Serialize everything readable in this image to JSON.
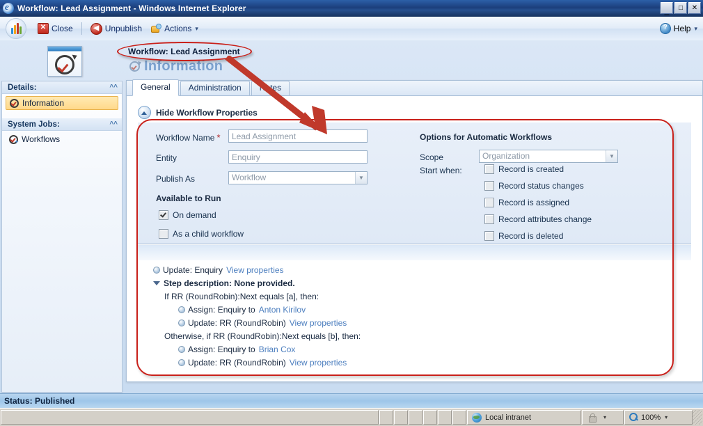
{
  "window": {
    "title": "Workflow: Lead Assignment - Windows Internet Explorer",
    "ie_icon": "internet-explorer-icon",
    "minimize": "_",
    "maximize": "□",
    "close": "✕"
  },
  "toolbar": {
    "app_logo": "dynamics-crm-logo",
    "close_label": "Close",
    "close_icon": "close-x-icon",
    "unpublish_label": "Unpublish",
    "unpublish_icon": "unpublish-icon",
    "actions_label": "Actions",
    "actions_icon": "actions-hand-icon",
    "actions_caret": "▾",
    "help_label": "Help",
    "help_icon": "help-question-icon",
    "help_caret": "▾"
  },
  "header": {
    "record_icon": "workflow-window-icon",
    "breadcrumb": "Workflow: Lead Assignment",
    "page_title": "Information",
    "page_title_icon": "workflow-check-icon"
  },
  "sidebar": {
    "groups": [
      {
        "header": "Details:",
        "collapse_icon": "chevron-up-icon",
        "items": [
          {
            "label": "Information",
            "icon": "workflow-check-icon",
            "selected": true
          }
        ]
      },
      {
        "header": "System Jobs:",
        "collapse_icon": "chevron-up-icon",
        "items": [
          {
            "label": "Workflows",
            "icon": "workflows-icon",
            "selected": false
          }
        ]
      }
    ]
  },
  "tabs": [
    {
      "label": "General",
      "active": true
    },
    {
      "label": "Administration",
      "active": false
    },
    {
      "label": "Notes",
      "active": false
    }
  ],
  "properties_section": {
    "toggle_label": "Hide Workflow Properties",
    "toggle_icon": "chevron-up-circle-icon",
    "fields": [
      {
        "label": "Workflow Name",
        "required": true,
        "value": "Lead Assignment",
        "type": "text"
      },
      {
        "label": "Entity",
        "required": false,
        "value": "Enquiry",
        "type": "text"
      },
      {
        "label": "Publish As",
        "required": false,
        "value": "Workflow",
        "type": "select"
      }
    ],
    "available_to_run": {
      "heading": "Available to Run",
      "options": [
        {
          "label": "On demand",
          "checked": true
        },
        {
          "label": "As a child workflow",
          "checked": false
        }
      ]
    },
    "automatic_options": {
      "heading": "Options for Automatic Workflows",
      "scope_label": "Scope",
      "scope_value": "Organization",
      "start_when_label": "Start when:",
      "triggers": [
        {
          "label": "Record is created",
          "checked": false
        },
        {
          "label": "Record status changes",
          "checked": false
        },
        {
          "label": "Record is assigned",
          "checked": false
        },
        {
          "label": "Record attributes change",
          "checked": false
        },
        {
          "label": "Record is deleted",
          "checked": false
        }
      ]
    }
  },
  "steps": {
    "rows": [
      {
        "indent": 0,
        "bullet": "dot",
        "text": "Update:  Enquiry",
        "link": "View properties",
        "bold": false
      },
      {
        "indent": 0,
        "bullet": "triangle",
        "text": "Step description: None provided.",
        "link": "",
        "bold": true
      },
      {
        "indent": 1,
        "bullet": "none",
        "text": "If RR (RoundRobin):Next equals [a], then:",
        "link": "",
        "bold": false
      },
      {
        "indent": 2,
        "bullet": "dot",
        "text": "Assign:  Enquiry  to",
        "link": "Anton Kirilov",
        "bold": false
      },
      {
        "indent": 2,
        "bullet": "dot",
        "text": "Update:  RR (RoundRobin)",
        "link": "View properties",
        "bold": false
      },
      {
        "indent": 1,
        "bullet": "none",
        "text": "Otherwise, if RR (RoundRobin):Next equals [b], then:",
        "link": "",
        "bold": false
      },
      {
        "indent": 2,
        "bullet": "dot",
        "text": "Assign:  Enquiry  to",
        "link": "Brian Cox",
        "bold": false
      },
      {
        "indent": 2,
        "bullet": "dot",
        "text": "Update:  RR (RoundRobin)",
        "link": "View properties",
        "bold": false
      }
    ]
  },
  "crm_status": {
    "text": "Status: Published"
  },
  "browser_status": {
    "message": "",
    "zone_label": "Local intranet",
    "zone_icon": "intranet-globe-icon",
    "protected_icon": "security-lock-icon",
    "protected_caret": "▾",
    "zoom_icon": "zoom-magnifier-icon",
    "zoom_level": "100%",
    "zoom_caret": "▾"
  },
  "annotations": {
    "ellipse_target": "breadcrumb-title",
    "arrow_from": "breadcrumb-title",
    "arrow_to": "workflow-properties-panel",
    "rect_target": "workflow-properties-and-steps",
    "color": "#c9201a"
  }
}
